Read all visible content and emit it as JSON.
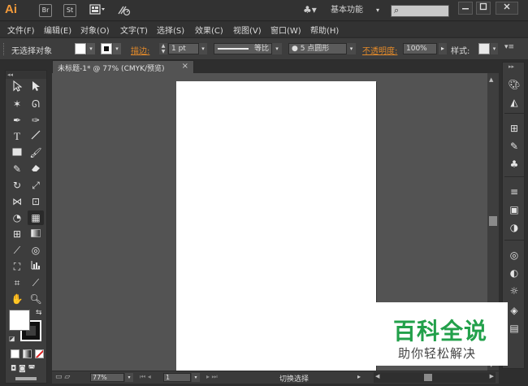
{
  "app": {
    "logo": "Ai",
    "bridge_label": "Br",
    "stock_label": "St",
    "arrange_icon": "arrange-documents-icon",
    "gpu_icon": "gpu-performance-icon",
    "workspace": "基本功能",
    "search_placeholder": "",
    "window_controls": [
      "minimize",
      "maximize",
      "close"
    ]
  },
  "menu": [
    "文件(F)",
    "编辑(E)",
    "对象(O)",
    "文字(T)",
    "选择(S)",
    "效果(C)",
    "视图(V)",
    "窗口(W)",
    "帮助(H)"
  ],
  "control_bar": {
    "selection_status": "无选择对象",
    "stroke_label": "描边:",
    "stroke_weight": "1 pt",
    "profile_label": "等比",
    "brush": "●  5 点圆形",
    "opacity_label": "不透明度:",
    "opacity_value": "100%",
    "style_label": "样式:",
    "fill_color": "#ffffff",
    "stroke_color": "#111111"
  },
  "document": {
    "tab_title": "未标题-1* @ 77% (CMYK/预览)",
    "close_glyph": "×"
  },
  "status_bar": {
    "zoom": "77%",
    "artboard_number": "1",
    "status_text": "切换选择"
  },
  "tools": [
    "selection-tool",
    "direct-selection-tool",
    "magic-wand-tool",
    "lasso-tool",
    "pen-tool",
    "curvature-tool",
    "type-tool",
    "line-segment-tool",
    "rectangle-tool",
    "paintbrush-tool",
    "pencil-tool",
    "eraser-tool",
    "rotate-tool",
    "scale-tool",
    "width-tool",
    "free-transform-tool",
    "shape-builder-tool",
    "perspective-grid-tool",
    "mesh-tool",
    "gradient-tool",
    "eyedropper-tool",
    "blend-tool",
    "symbol-sprayer-tool",
    "column-graph-tool",
    "artboard-tool",
    "slice-tool",
    "hand-tool",
    "zoom-tool"
  ],
  "dock_panels": [
    "color-panel",
    "color-guide-panel",
    "swatches-panel",
    "brushes-panel",
    "symbols-panel",
    "stroke-panel",
    "gradient-panel",
    "transparency-panel",
    "appearance-panel",
    "graphic-styles-panel",
    "layers-panel",
    "artboards-panel"
  ],
  "watermark": {
    "title": "百科全说",
    "subtitle": "助你轻松解决",
    "color": "#22a04a"
  }
}
